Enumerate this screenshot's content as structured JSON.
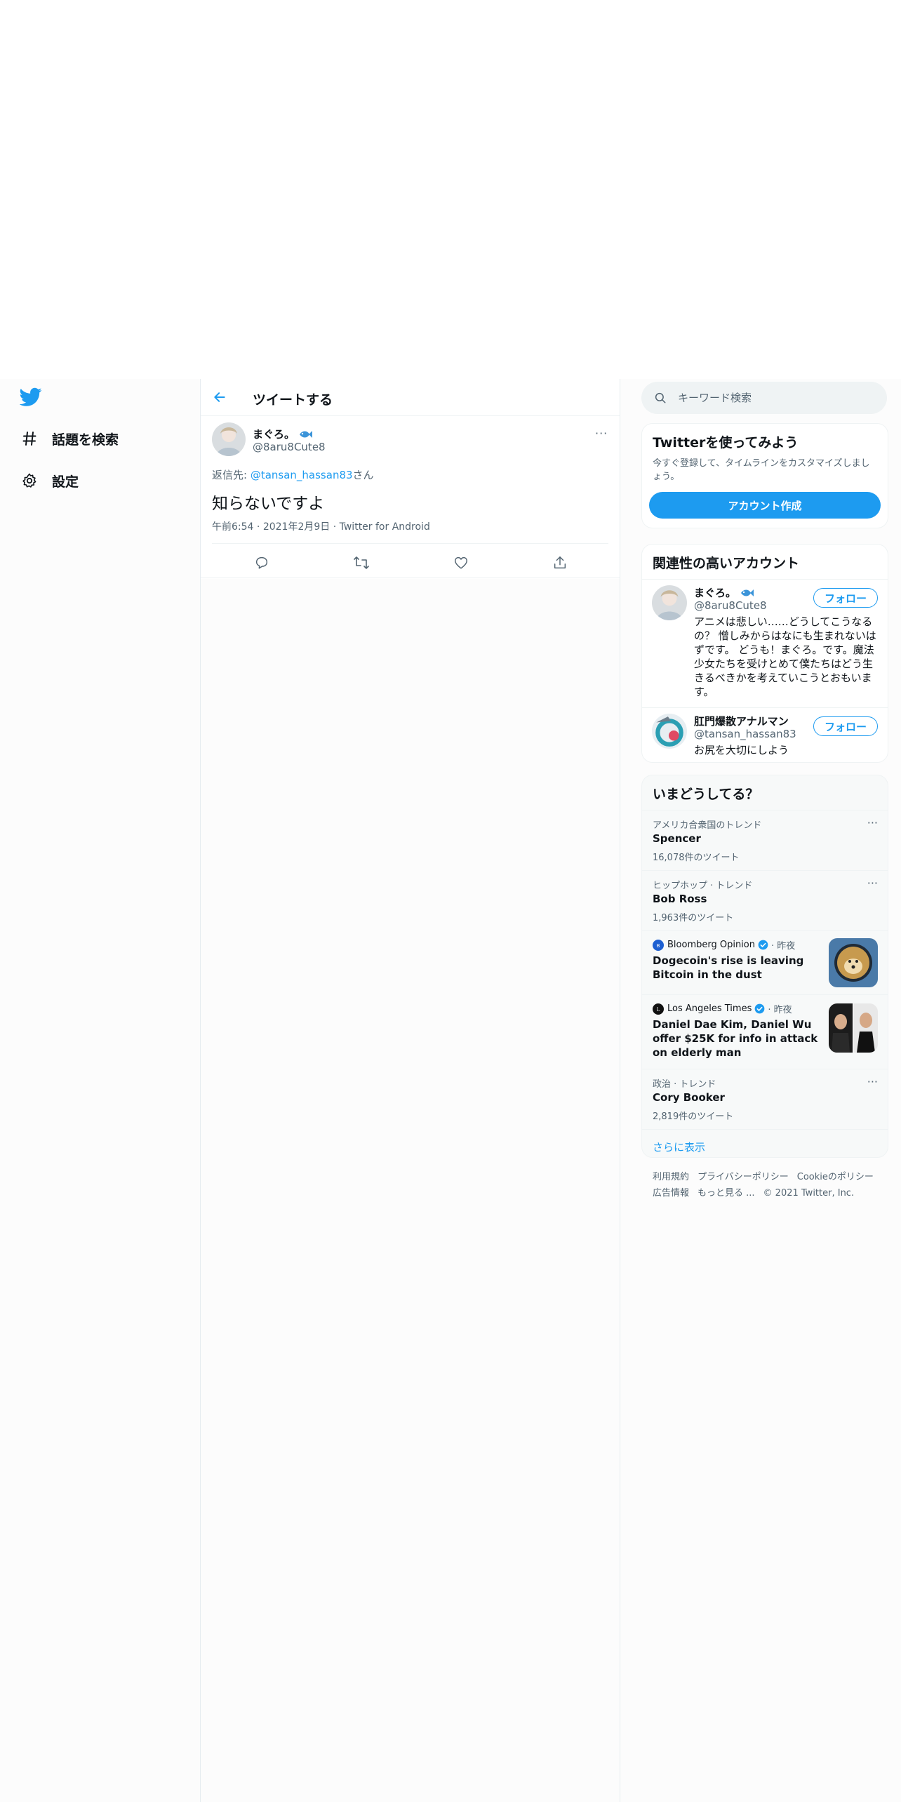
{
  "nav": {
    "items": [
      {
        "label": "話題を検索"
      },
      {
        "label": "設定"
      }
    ]
  },
  "header": {
    "title": "ツイートする"
  },
  "tweet": {
    "name": "まぐろ。",
    "handle": "@8aru8Cute8",
    "reply_prefix": "返信先: ",
    "reply_to": "@tansan_hassan83",
    "reply_suffix": "さん",
    "text": "知らないですよ",
    "time": "午前6:54",
    "date": "2021年2月9日",
    "source": "Twitter for Android",
    "more": "···"
  },
  "search": {
    "placeholder": "キーワード検索"
  },
  "signup": {
    "title": "Twitterを使ってみよう",
    "desc": "今すぐ登録して、タイムラインをカスタマイズしましょう。",
    "button": "アカウント作成"
  },
  "relevant": {
    "title": "関連性の高いアカウント",
    "accounts": [
      {
        "name": "まぐろ。",
        "handle": "@8aru8Cute8",
        "bio": "アニメは悲しい……どうしてこうなるの？ 憎しみからはなにも生まれないはずです。 どうも！まぐろ。です。魔法少女たちを受けとめて僕たちはどう生きるべきかを考えていこうとおもいます。",
        "follow": "フォロー"
      },
      {
        "name": "肛門爆散アナルマン",
        "handle": "@tansan_hassan83",
        "bio": "お尻を大切にしよう",
        "follow": "フォロー"
      }
    ]
  },
  "trends": {
    "title": "いまどうしてる？",
    "items": [
      {
        "context": "アメリカ合衆国のトレンド",
        "name": "Spencer",
        "count": "16,078件のツイート"
      },
      {
        "context": "ヒップホップ · トレンド",
        "name": "Bob Ross",
        "count": "1,963件のツイート"
      }
    ],
    "news": [
      {
        "source": "Bloomberg Opinion",
        "time": "· 昨夜",
        "text": "Dogecoin's rise is leaving Bitcoin in the dust"
      },
      {
        "source": "Los Angeles Times",
        "time": "· 昨夜",
        "text": "Daniel Dae Kim, Daniel Wu offer $25K for info in attack on elderly man"
      }
    ],
    "last": {
      "context": "政治 · トレンド",
      "name": "Cory Booker",
      "count": "2,819件のツイート"
    },
    "more": "···",
    "show_more": "さらに表示"
  },
  "footer": {
    "links": [
      "利用規約",
      "プライバシーポリシー",
      "Cookieのポリシー",
      "広告情報",
      "もっと見る ..."
    ],
    "copyright": "© 2021 Twitter, Inc."
  },
  "colors": {
    "accent": "#1d9bf0",
    "text": "#0f1419",
    "muted": "#536471"
  }
}
